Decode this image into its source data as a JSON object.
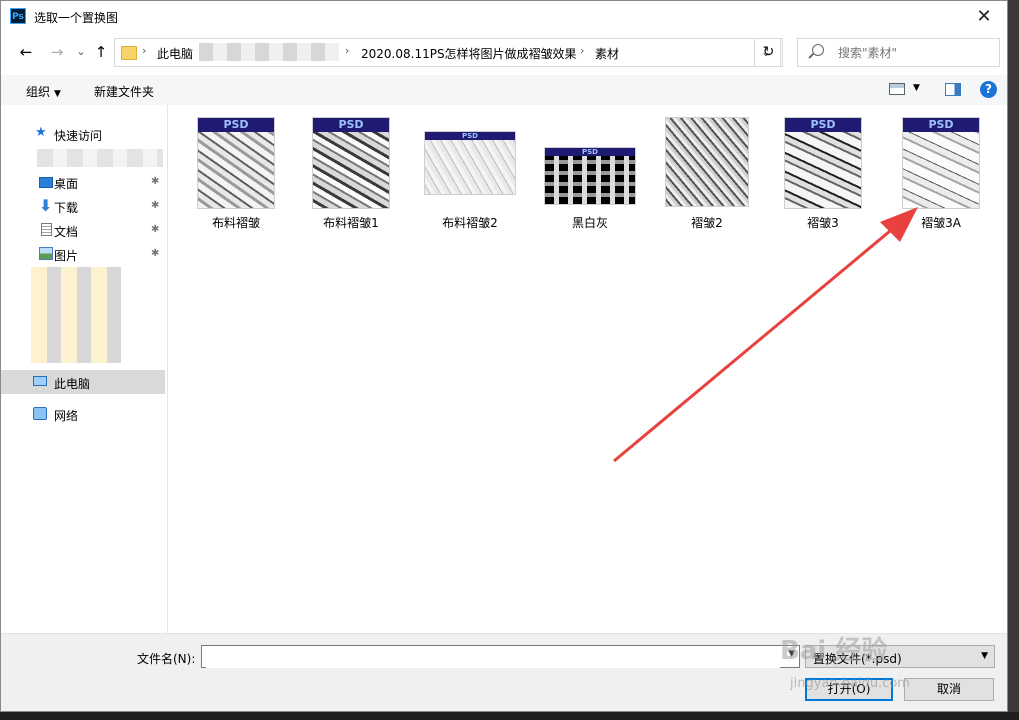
{
  "window": {
    "title": "选取一个置换图",
    "app_badge": "Ps",
    "close_glyph": "✕"
  },
  "nav": {
    "back": "←",
    "forward": "→",
    "history": "⌄",
    "up": "↑",
    "crumbs": [
      "此电脑",
      "2020.08.11PS怎样将图片做成褶皱效果",
      "素材"
    ],
    "sep": "›",
    "refresh": "↻",
    "search_placeholder": "搜索\"素材\""
  },
  "toolbar": {
    "organize": "组织",
    "new_folder": "新建文件夹",
    "help": "?"
  },
  "sidebar": {
    "quick_access": "快速访问",
    "items": [
      {
        "label": "桌面"
      },
      {
        "label": "下载"
      },
      {
        "label": "文档"
      },
      {
        "label": "图片"
      }
    ],
    "this_pc": "此电脑",
    "network": "网络",
    "pin_glyph": "✱"
  },
  "files": [
    {
      "name": "布料褶皱",
      "badge": "PSD"
    },
    {
      "name": "布料褶皱1",
      "badge": "PSD"
    },
    {
      "name": "布料褶皱2",
      "badge": "PSD"
    },
    {
      "name": "黑白灰",
      "badge": "PSD"
    },
    {
      "name": "褶皱2"
    },
    {
      "name": "褶皱3",
      "badge": "PSD"
    },
    {
      "name": "褶皱3A",
      "badge": "PSD"
    }
  ],
  "footer": {
    "filename_label": "文件名(N):",
    "filename_value": "",
    "filetype_value": "置换文件(*.psd)",
    "open": "打开(O)",
    "cancel": "取消"
  },
  "watermark": {
    "main": "Bai  经验",
    "sub": "jingyan.baidu.com"
  },
  "colors": {
    "accent": "#1a73d9",
    "annotation_arrow": "#e8413e",
    "psd_banner": "#1f1a72"
  }
}
